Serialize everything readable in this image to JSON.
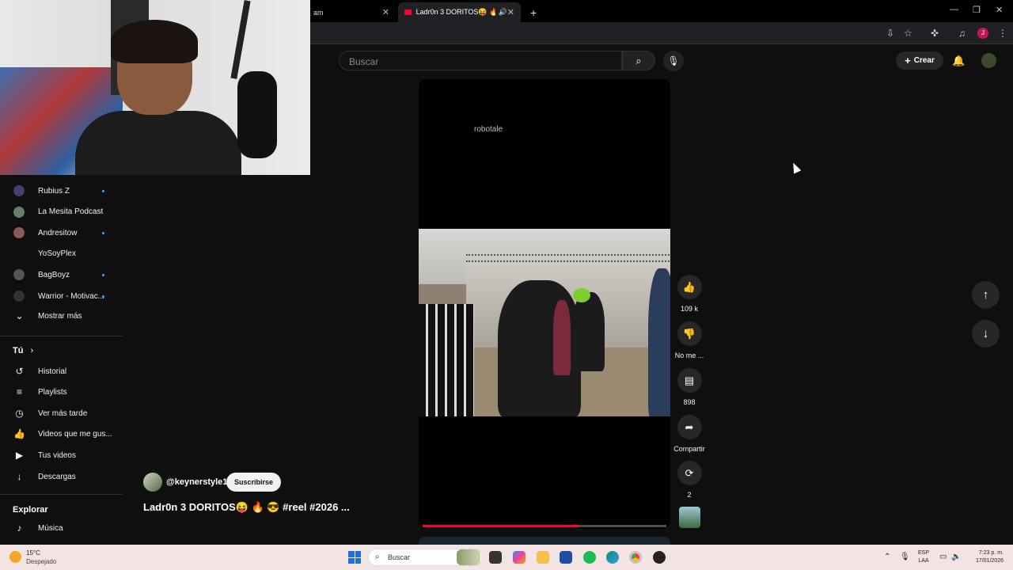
{
  "browser": {
    "tabs": [
      {
        "label": "am",
        "active": false
      },
      {
        "label": "Ladr0n 3 DORITOS😝 🔥 😎",
        "active": true
      }
    ],
    "new_tab": "+",
    "avatar_letter": "J"
  },
  "header": {
    "search_placeholder": "Buscar",
    "create_label": "Crear"
  },
  "sidebar": {
    "subscriptions": [
      {
        "label": "Rubius Z",
        "new": true,
        "color": "#4b3b6e"
      },
      {
        "label": "La Mesita Podcast",
        "new": false,
        "color": "#6b7d6b"
      },
      {
        "label": "Andresitow",
        "new": true,
        "color": "#8a5a5a"
      },
      {
        "label": "YoSoyPlex",
        "new": false,
        "color": "#111111"
      },
      {
        "label": "BagBoyz",
        "new": true,
        "color": "#555555"
      },
      {
        "label": "Warrior - Motivac...",
        "new": true,
        "color": "#333333"
      }
    ],
    "show_more": "Mostrar más",
    "you_section": "Tú",
    "you_items": [
      {
        "label": "Historial",
        "icon": "history-icon",
        "glyph": "↺"
      },
      {
        "label": "Playlists",
        "icon": "playlists-icon",
        "glyph": "≡"
      },
      {
        "label": "Ver más tarde",
        "icon": "watch-later-icon",
        "glyph": "◷"
      },
      {
        "label": "Videos que me gus...",
        "icon": "liked-videos-icon",
        "glyph": "👍"
      },
      {
        "label": "Tus videos",
        "icon": "your-videos-icon",
        "glyph": "▶"
      },
      {
        "label": "Descargas",
        "icon": "downloads-icon",
        "glyph": "↓"
      }
    ],
    "explore_section": "Explorar",
    "explore_items": [
      {
        "label": "Música",
        "icon": "music-icon",
        "glyph": "♪"
      }
    ]
  },
  "short": {
    "watermark": "robotale",
    "progress": 0.64,
    "channel_handle": "@keynerstyle1",
    "subscribe_label": "Suscribirse",
    "title": "Ladr0n 3 DORITOS😝 🔥 😎 #reel #2026 ..."
  },
  "actions": {
    "like_count": "109 k",
    "dislike_label": "No me ...",
    "comments_count": "898",
    "share_label": "Compartir",
    "remix_count": "2"
  },
  "taskbar": {
    "temperature": "15°C",
    "weather": "Despejado",
    "search_placeholder": "Buscar",
    "language_line1": "ESP",
    "language_line2": "LAA",
    "time": "7:23 p. m.",
    "date": "17/01/2026"
  },
  "colors": {
    "accent": "#ff0033",
    "background": "#0f0f0f",
    "new_dot": "#3ea6ff"
  }
}
